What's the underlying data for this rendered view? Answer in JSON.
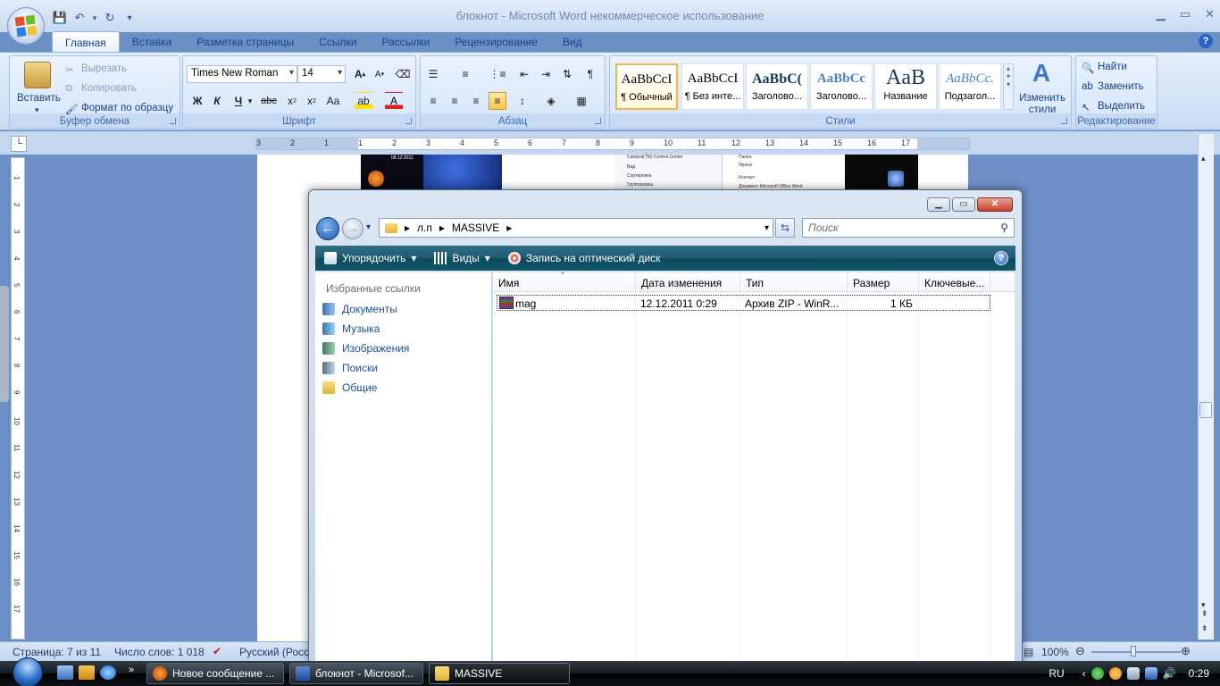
{
  "word": {
    "title": "блокнот - Microsoft Word некоммерческое использование",
    "tabs": [
      "Главная",
      "Вставка",
      "Разметка страницы",
      "Ссылки",
      "Рассылки",
      "Рецензирование",
      "Вид"
    ],
    "clipboard": {
      "paste": "Вставить",
      "cut": "Вырезать",
      "copy": "Копировать",
      "format_painter": "Формат по образцу",
      "label": "Буфер обмена"
    },
    "font": {
      "family": "Times New Roman",
      "size": "14",
      "label": "Шрифт"
    },
    "paragraph": {
      "label": "Абзац"
    },
    "styles": {
      "label": "Стили",
      "items": [
        {
          "sample": "AaBbCcI",
          "name": "¶ Обычный"
        },
        {
          "sample": "AaBbCcI",
          "name": "¶ Без инте..."
        },
        {
          "sample": "AaBbC(",
          "name": "Заголово..."
        },
        {
          "sample": "AaBbCc",
          "name": "Заголово..."
        },
        {
          "sample": "AaB",
          "name": "Название"
        },
        {
          "sample": "AaBbCc.",
          "name": "Подзагол..."
        }
      ],
      "change_styles": "Изменить стили"
    },
    "editing": {
      "find": "Найти",
      "replace": "Заменить",
      "select": "Выделить",
      "label": "Редактирование"
    },
    "ruler_numbers": [
      "3",
      "2",
      "1",
      "1",
      "2",
      "3",
      "4",
      "5",
      "6",
      "7",
      "8",
      "9",
      "10",
      "11",
      "12",
      "13",
      "14",
      "15",
      "16",
      "17"
    ],
    "vruler_numbers": [
      "1",
      "2",
      "3",
      "4",
      "5",
      "6",
      "7",
      "8",
      "9",
      "10",
      "11",
      "12",
      "13",
      "14",
      "15",
      "16",
      "17"
    ],
    "status": {
      "page": "Страница: 7 из 11",
      "words": "Число слов: 1 018",
      "language": "Русский (Росси",
      "zoom": "100%"
    },
    "doc_image_texts": {
      "date": "08.12.2011",
      "menu": [
        "Catalyst(TM) Control Center",
        "Вид",
        "Сортировка",
        "Группировка"
      ],
      "menu2": [
        "Папка",
        "Ярлык",
        "Контакт",
        "Документ Microsoft Office Word"
      ]
    }
  },
  "explorer": {
    "path": [
      "л.п",
      "MASSIVE"
    ],
    "search_placeholder": "Поиск",
    "commands": {
      "organize": "Упорядочить",
      "views": "Виды",
      "burn": "Запись на оптический диск"
    },
    "favorites_header": "Избранные ссылки",
    "favorites": [
      "Документы",
      "Музыка",
      "Изображения",
      "Поиски",
      "Общие"
    ],
    "columns": [
      "Имя",
      "Дата изменения",
      "Тип",
      "Размер",
      "Ключевые..."
    ],
    "files": [
      {
        "name": "mag",
        "date": "12.12.2011 0:29",
        "type": "Архив ZIP - WinR...",
        "size": "1 КБ"
      }
    ]
  },
  "taskbar": {
    "tasks": [
      {
        "label": "Новое сообщение ...",
        "color": "#e87a1d"
      },
      {
        "label": "блокнот - Microsof...",
        "color": "#2b5cab"
      },
      {
        "label": "MASSIVE",
        "color": "#e6b93b"
      }
    ],
    "tray": {
      "lang": "RU",
      "time": "0:29"
    }
  },
  "colors": {
    "ribbon": "#dae8fa",
    "explorer_cmdbar": "#1e5a6f",
    "taskbar": "#141a20"
  }
}
